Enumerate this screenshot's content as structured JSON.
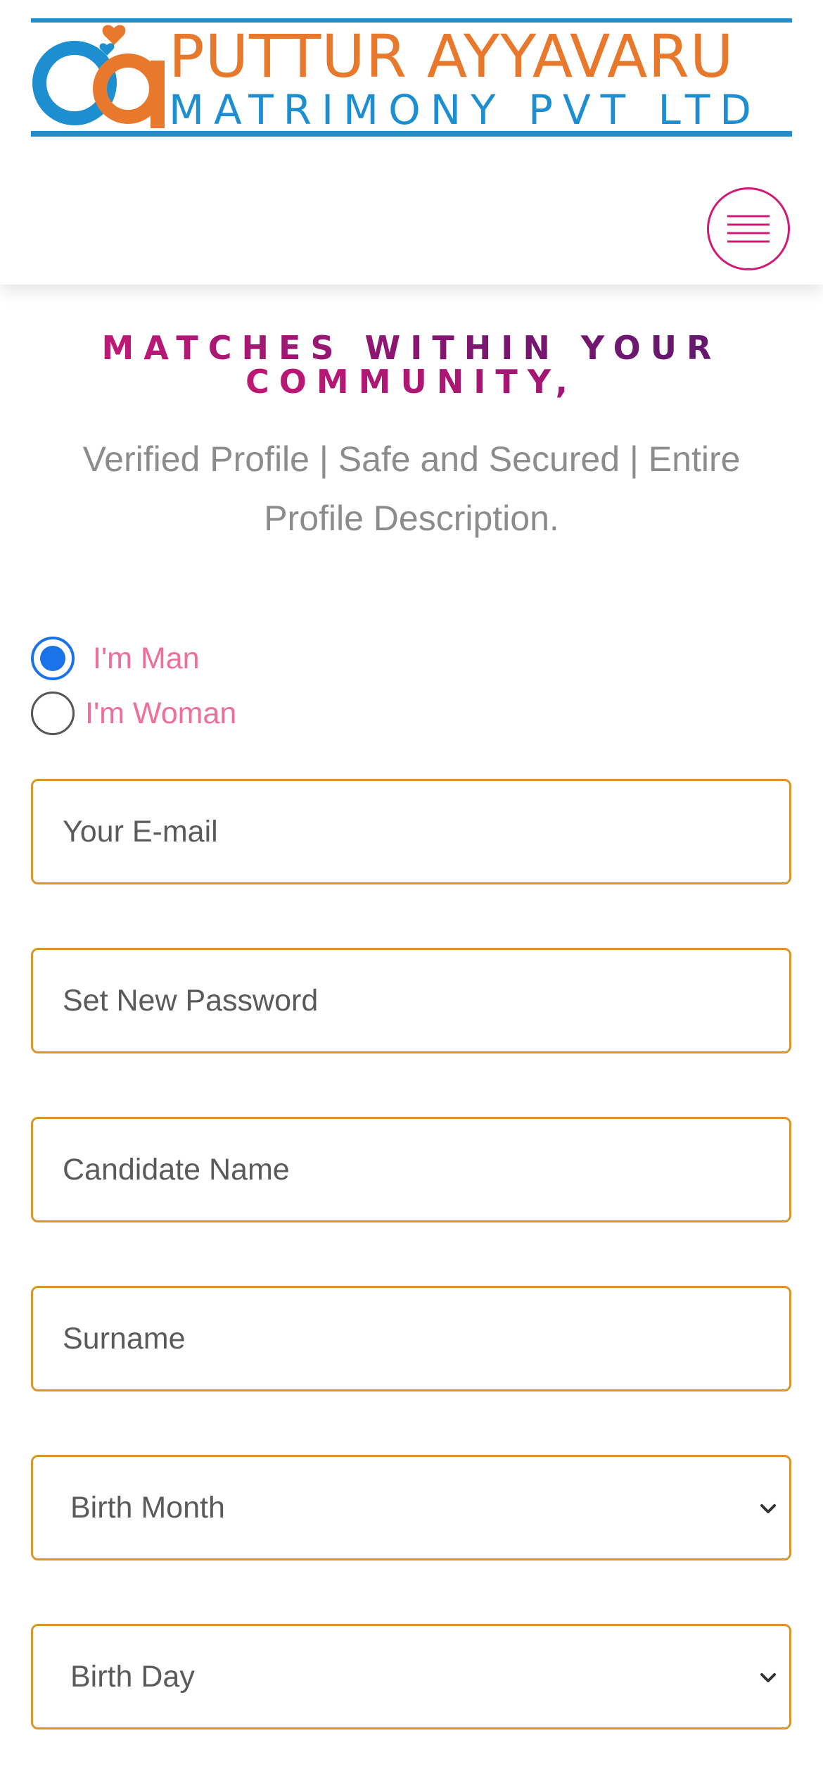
{
  "header": {
    "logo": {
      "line1": "PUTTUR AYYAVARU",
      "line2": "MATRIMONY PVT LTD",
      "colors": {
        "orange": "#e8782b",
        "blue": "#1d8fd0"
      }
    },
    "menu_icon": "hamburger-menu-icon"
  },
  "hero": {
    "headline_line1": "MATCHES WITHIN YOUR",
    "headline_line2": "COMMUNITY,",
    "subtitle": "Verified Profile | Safe and Secured | Entire Profile Description."
  },
  "form": {
    "gender_options": [
      {
        "label": "I'm Man",
        "selected": true
      },
      {
        "label": "I'm Woman",
        "selected": false
      }
    ],
    "fields": {
      "email": {
        "placeholder": "Your E-mail",
        "value": ""
      },
      "password": {
        "placeholder": "Set New Password",
        "value": ""
      },
      "candidate_name": {
        "placeholder": "Candidate Name",
        "value": ""
      },
      "surname": {
        "placeholder": "Surname",
        "value": ""
      }
    },
    "selects": {
      "birth_month": {
        "selected": "Birth Month"
      },
      "birth_day": {
        "selected": "Birth Day"
      }
    }
  },
  "colors": {
    "accent_magenta": "#d11a77",
    "field_border": "#d99532",
    "radio_blue": "#1a73e8",
    "radio_label_pink": "#ef6e9a"
  }
}
